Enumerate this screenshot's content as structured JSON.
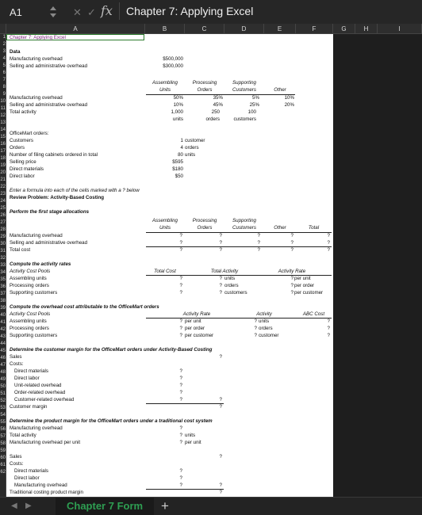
{
  "formula_bar": {
    "name_box": "A1",
    "fx": "fx",
    "value": "Chapter 7: Applying Excel"
  },
  "columns": [
    "A",
    "B",
    "C",
    "D",
    "E",
    "F",
    "G",
    "H",
    "I"
  ],
  "row_numbers": [
    "1",
    "2",
    "3",
    "4",
    "5",
    "6",
    "7",
    "8",
    "9",
    "10",
    "11",
    "12",
    "13",
    "14",
    "15",
    "16",
    "17",
    "18",
    "19",
    "20",
    "21",
    "22",
    "23",
    "24",
    "25",
    "26",
    "27",
    "28",
    "29",
    "30",
    "31",
    "32",
    "33",
    "34",
    "35",
    "36",
    "37",
    "38",
    "39",
    "40",
    "41",
    "42",
    "43",
    "44",
    "45",
    "46",
    "47",
    "48",
    "49",
    "50",
    "51",
    "52",
    "53",
    "54",
    "55",
    "56",
    "57",
    "58",
    "59",
    "60",
    "61",
    "62"
  ],
  "sheet": {
    "title": "Chapter 7: Applying Excel",
    "data": "Data",
    "mfg_overhead": "Manufacturing overhead",
    "sell_admin": "Selling and administrative overhead",
    "mfg_overhead_val": "$500,000",
    "sell_admin_val": "$300,000",
    "hdr_assembling": "Assembling",
    "hdr_units": "Units",
    "hdr_processing": "Processing",
    "hdr_orders": "Orders",
    "hdr_supporting": "Supporting",
    "hdr_customers": "Customers",
    "hdr_other": "Other",
    "mo_pct": [
      "50%",
      "35%",
      "5%",
      "10%"
    ],
    "sa_pct": [
      "10%",
      "45%",
      "25%",
      "20%"
    ],
    "total_activity": "Total activity",
    "ta_vals": [
      "1,000",
      "250",
      "100"
    ],
    "ta_units": [
      "units",
      "orders",
      "customers"
    ],
    "officemart_orders": "OfficeMart orders:",
    "customers": "Customers",
    "orders": "Orders",
    "filing": "Number of filing cabinets ordered in total",
    "selling_price": "Selling price",
    "direct_materials": "Direct materials",
    "direct_labor": "Direct labor",
    "om_vals": [
      "1",
      "4",
      "80",
      "$595",
      "$180",
      "$50"
    ],
    "om_units": [
      "customer",
      "orders",
      "units"
    ],
    "enter_formula": "Enter a formula into each of the cells marked with a ? below",
    "review": "Review Problem: Activity-Based Costing",
    "first_stage": "Perform the first stage allocations",
    "total": "Total",
    "total_cost": "Total cost",
    "q": "?",
    "compute_rates": "Compute the activity rates",
    "activity_cost_pools": "Activity Cost Pools",
    "hdr_total_cost": "Total Cost",
    "hdr_total_activity": "Total Activity",
    "hdr_activity_rate": "Activity Rate",
    "assembling_units": "Assembling units",
    "processing_orders": "Processing orders",
    "supporting_customers": "Supporting customers",
    "u_units": "units",
    "u_orders": "orders",
    "u_customers": "customers",
    "per_unit": "per unit",
    "per_order": "per order",
    "per_customer": "per customer",
    "compute_overhead": "Compute the overhead cost attributable to the OfficeMart orders",
    "hdr_activity": "Activity",
    "hdr_abc_cost": "ABC Cost",
    "u_customer": "customer",
    "customer_margin_title": "Determine the customer margin for the OfficeMart orders under Activity-Based Costing",
    "sales": "Sales",
    "costs": "Costs:",
    "unit_related": "Unit-related overhead",
    "order_related": "Order-related overhead",
    "customer_related": "Customer-related overhead",
    "customer_margin": "Customer margin",
    "product_margin_title": "Determine the product margin for the OfficeMart orders under a traditional cost system",
    "mfg_overhead_per_unit": "Manufacturing overhead per unit",
    "manufacturing_overhead": "Manufacturing overhead",
    "traditional_margin": "Traditional costing product margin"
  },
  "tabs": {
    "active": "Chapter 7 Form",
    "add": "+"
  }
}
